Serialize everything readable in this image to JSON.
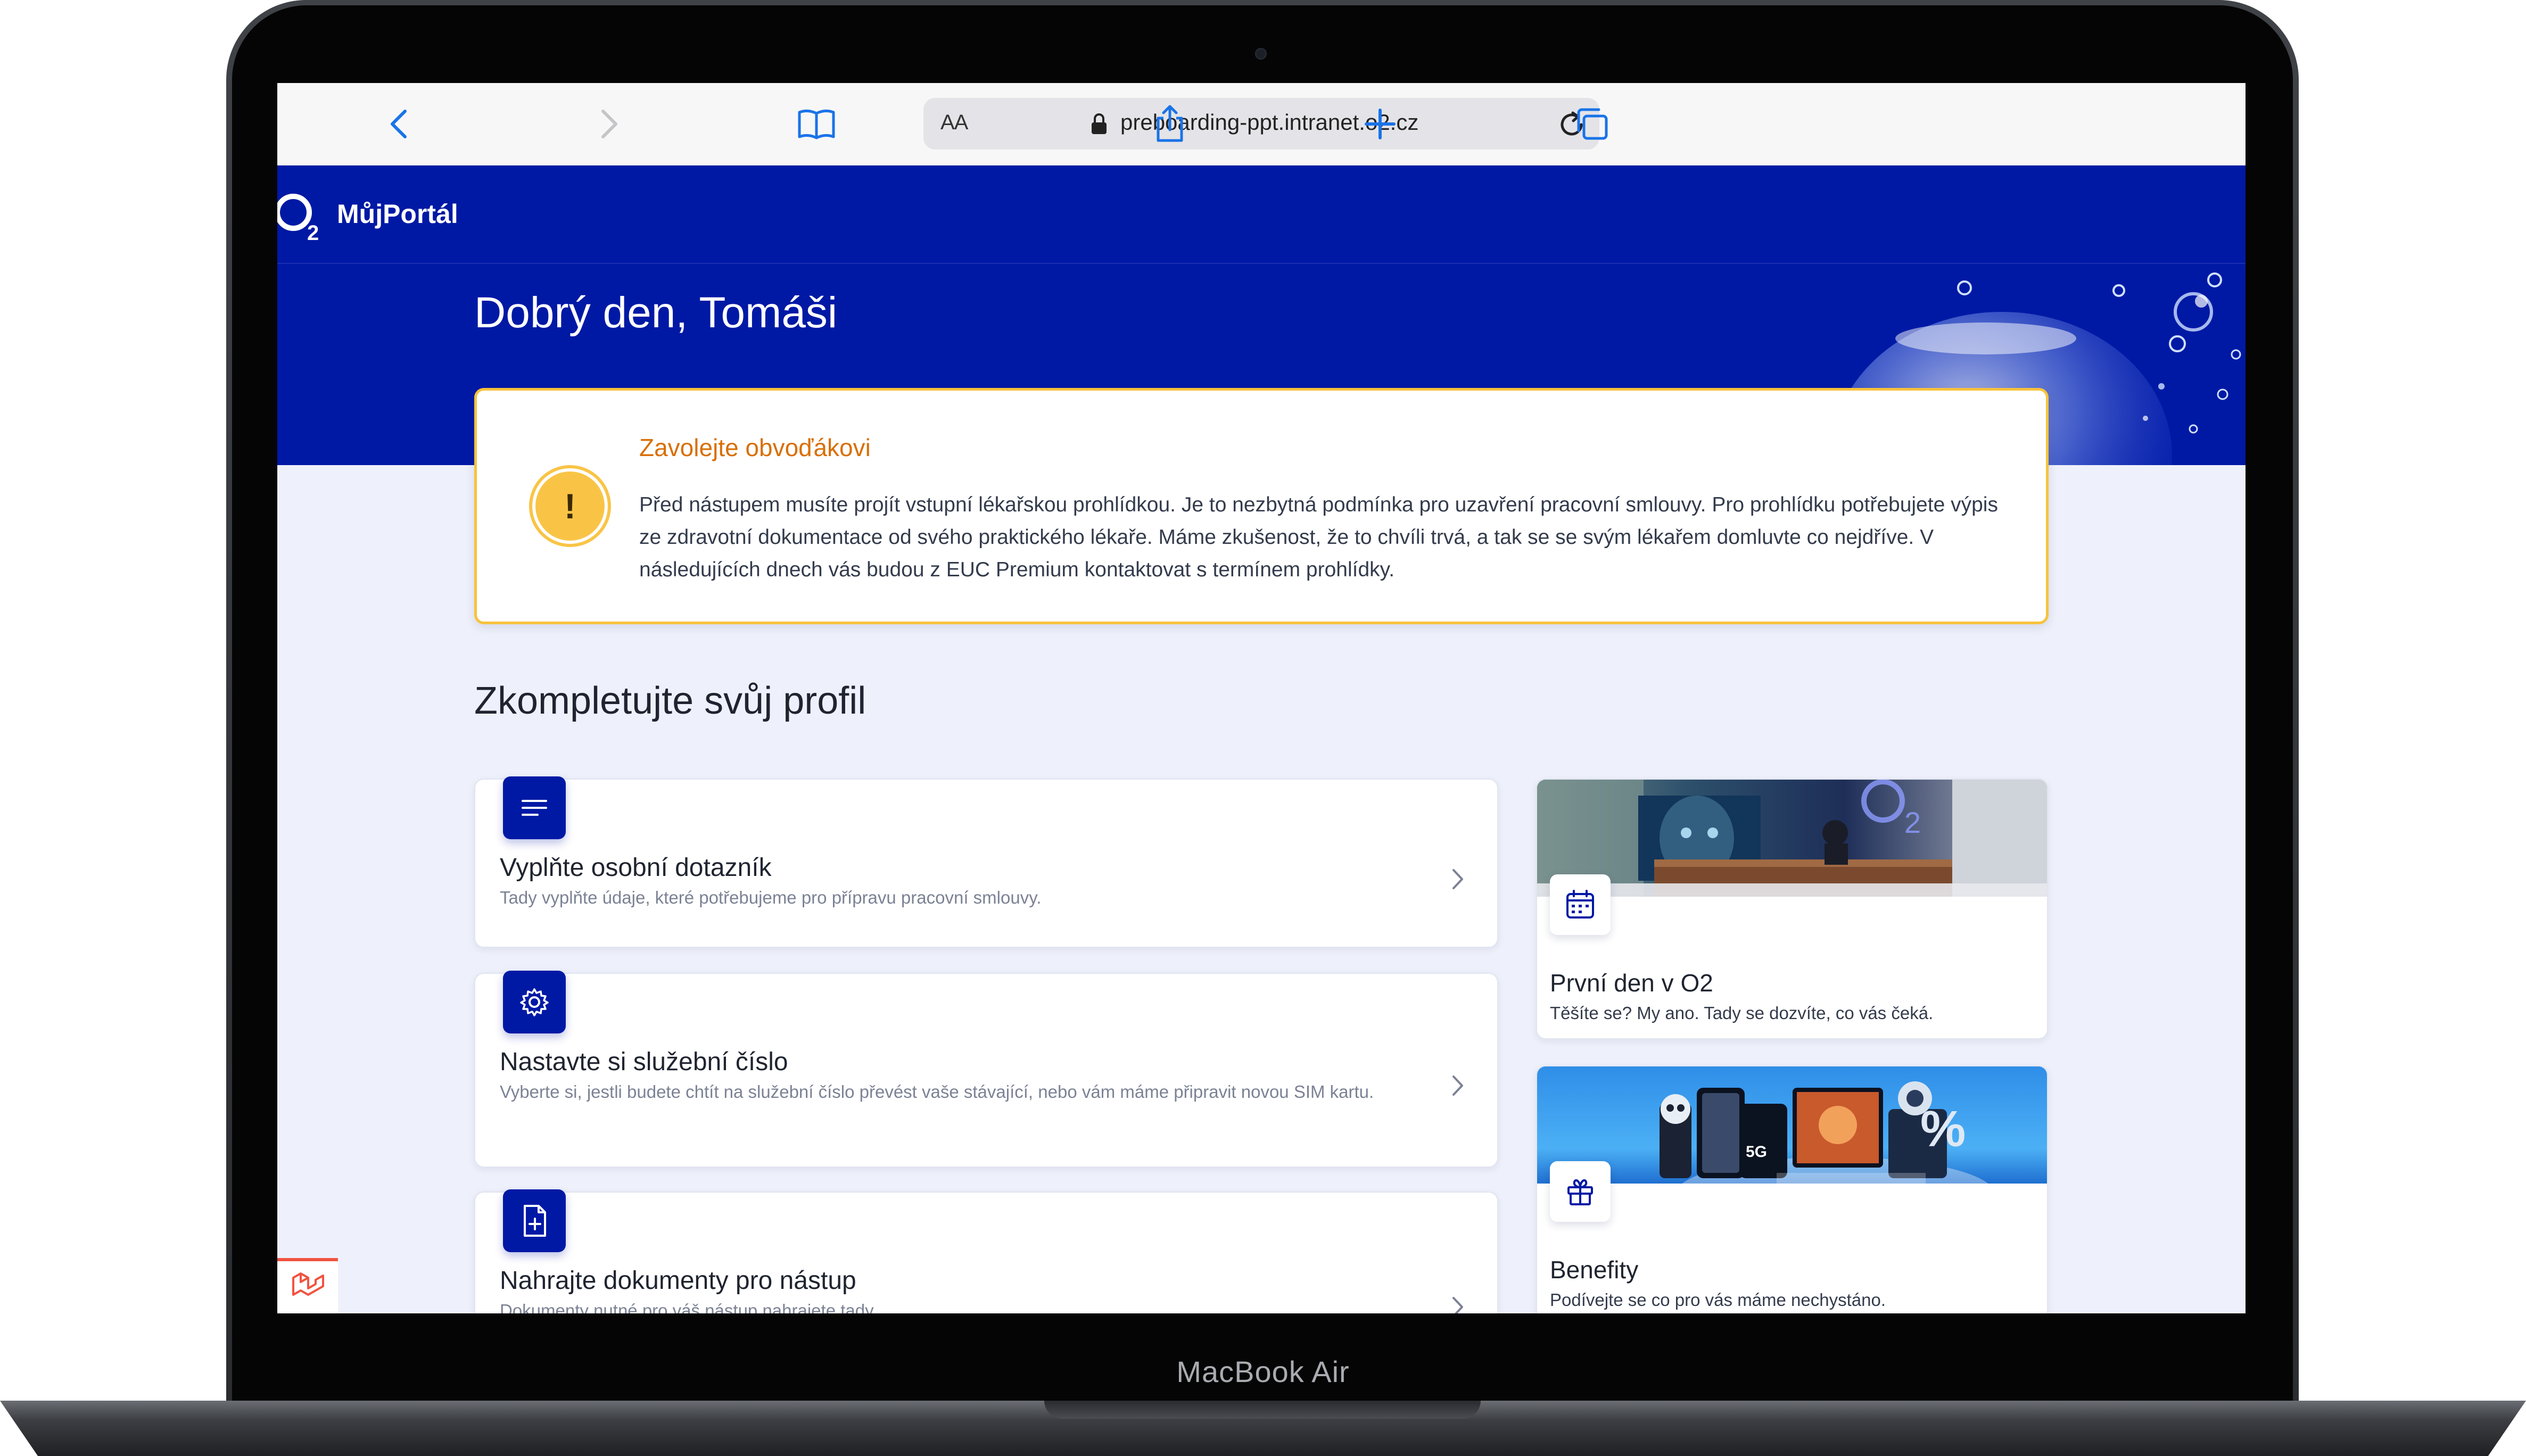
{
  "device": {
    "label": "MacBook Air"
  },
  "browser": {
    "text_size_label": "AA",
    "url": "preboarding-ppt.intranet.o2.cz",
    "icons": [
      "chevron-left-icon",
      "chevron-right-icon",
      "bookmarks-icon",
      "lock-icon",
      "reload-icon",
      "share-icon",
      "plus-icon",
      "tabs-icon"
    ]
  },
  "header": {
    "logo_text": "O",
    "logo_sub": "2",
    "portal_name": "MůjPortál",
    "greeting": "Dobrý den, Tomáši"
  },
  "alert": {
    "icon": "!",
    "title": "Zavolejte obvoďákovi",
    "text": "Před nástupem musíte projít vstupní lékařskou prohlídkou. Je to nezbytná podmínka pro uzavření pracovní smlouvy. Pro prohlídku potřebujete výpis ze zdravotní dokumentace od svého praktického lékaře. Máme zkušenost, že to chvíli trvá, a tak se se svým lékařem domluvte co nejdříve. V následujících dnech vás budou z EUC Premium kontaktovat s termínem prohlídky.",
    "colors": {
      "border": "#f7c23c",
      "title": "#d86f06",
      "icon_bg": "#f9c446"
    }
  },
  "section": {
    "title": "Zkompletujte svůj profil"
  },
  "tasks": [
    {
      "icon": "list-icon",
      "title": "Vyplňte osobní dotazník",
      "description": "Tady vyplňte údaje, které potřebujeme pro přípravu pracovní smlouvy."
    },
    {
      "icon": "gear-icon",
      "title": "Nastavte si služební číslo",
      "description": "Vyberte si, jestli budete chtít na služební číslo převést vaše stávající, nebo vám máme připravit novou SIM kartu."
    },
    {
      "icon": "document-plus-icon",
      "title": "Nahrajte dokumenty pro nástup",
      "description": "Dokumenty nutné pro váš nástup nahrajete tady."
    }
  ],
  "side_cards": [
    {
      "icon": "calendar-icon",
      "title": "První den v O2",
      "description": "Těšíte se? My ano. Tady se dozvíte, co vás čeká."
    },
    {
      "icon": "gift-icon",
      "title": "Benefity",
      "description": "Podívejte se co pro vás máme nechystáno."
    }
  ],
  "theme": {
    "brand_blue": "#0019a5",
    "page_bg": "#eef1fb",
    "link_blue": "#1a73e8"
  }
}
